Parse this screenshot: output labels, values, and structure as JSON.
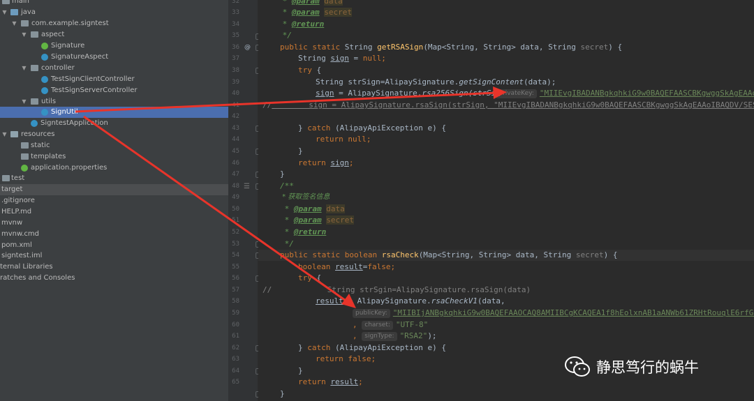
{
  "project_tree": {
    "items": [
      {
        "label": "main"
      },
      {
        "label": "java"
      },
      {
        "label": "com.example.signtest"
      },
      {
        "label": "aspect"
      },
      {
        "label": "Signature"
      },
      {
        "label": "SignatureAspect"
      },
      {
        "label": "controller"
      },
      {
        "label": "TestSignClientController"
      },
      {
        "label": "TestSignServerController"
      },
      {
        "label": "utils"
      },
      {
        "label": "SignUtil"
      },
      {
        "label": "SigntestApplication"
      },
      {
        "label": "resources"
      },
      {
        "label": "static"
      },
      {
        "label": "templates"
      },
      {
        "label": "application.properties"
      },
      {
        "label": "test"
      },
      {
        "label": "target"
      },
      {
        "label": ".gitignore"
      },
      {
        "label": "HELP.md"
      },
      {
        "label": "mvnw"
      },
      {
        "label": "mvnw.cmd"
      },
      {
        "label": "pom.xml"
      },
      {
        "label": "signtest.iml"
      },
      {
        "label": "ternal Libraries"
      },
      {
        "label": "ratches and Consoles"
      }
    ]
  },
  "gutter": {
    "line_numbers": [
      "32",
      "33",
      "34",
      "35",
      "36",
      "37",
      "38",
      "39",
      "40",
      "41",
      "42",
      "43",
      "44",
      "45",
      "46",
      "47",
      "48",
      "49",
      "50",
      "51",
      "52",
      "53",
      "54",
      "55",
      "56",
      "57",
      "58",
      "59",
      "60",
      "61",
      "62",
      "63",
      "64",
      "65"
    ],
    "annotation_marker": "@"
  },
  "code": {
    "l32": {
      "star": " * ",
      "tag": "@param",
      "par": "data"
    },
    "l33": {
      "star": " * ",
      "tag": "@param",
      "par": "secret"
    },
    "l34": {
      "star": " * ",
      "tag": "@return"
    },
    "l35": {
      "text": " */"
    },
    "l36": {
      "kw1": "public static ",
      "type1": "String ",
      "name": "getRSASign",
      "sig": "(Map<String, String> data, String ",
      "secret": "secret",
      "end": ") {"
    },
    "l37": {
      "type": "String ",
      "var": "sign",
      "eq": " = ",
      "kw": "null",
      "end": ";"
    },
    "l38": {
      "kw": "try",
      "end": " {"
    },
    "l39": {
      "a": "String strSign=AlipaySignature.",
      "b": "getSignContent",
      "c": "(data);"
    },
    "l40": {
      "var": "sign",
      "a": " = AlipaySignature.",
      "b": "rsa256Sign(strSi",
      "hint": "privateKey:",
      "str": "\"MIIEvgIBADANBgkqhkiG9w0BAQEFAASCBKgwggSkAgEAAoIBAQDV/SES"
    },
    "l41": {
      "cmt": "//",
      "code": "        sign = AlipaySignature.rsaSign(strSign, \"MIIEvgIBADANBgkqhkiG9w0BAQEFAASCBKgwggSkAgEAAoIBAQDV/SES"
    },
    "l42": {
      "text": ""
    },
    "l43": {
      "a": "} ",
      "kw": "catch",
      "b": " (AlipayApiException e) {"
    },
    "l44": {
      "kw": "return null",
      "end": ";"
    },
    "l45": {
      "text": "}"
    },
    "l46": {
      "kw": "return ",
      "var": "sign",
      "end": ";"
    },
    "l47": {
      "text": "}"
    },
    "l48": {
      "text": "/**"
    },
    "l49": {
      "text": " * 获取签名信息"
    },
    "l50": {
      "star": " * ",
      "tag": "@param",
      "par": "data"
    },
    "l51": {
      "star": " * ",
      "tag": "@param",
      "par": "secret"
    },
    "l52": {
      "star": " * ",
      "tag": "@return"
    },
    "l53": {
      "text": " */"
    },
    "l54": {
      "kw1": "public static boolean ",
      "name": "rsaCheck",
      "sig": "(Map<String, String> data, String ",
      "secret": "secret",
      "end": ") {"
    },
    "l55": {
      "kw": "boolean ",
      "var": "result",
      "eq": "=",
      "kw2": "false",
      "end": ";"
    },
    "l56": {
      "kw": "try",
      "end": " {"
    },
    "l57": {
      "cmt": "//",
      "code": "            String strSgin=AlipaySignature.rsaSign(data)"
    },
    "l58": {
      "var": "result",
      "a": " = AlipaySignature.",
      "b": "rsaCheckV1",
      "c": "(data,"
    },
    "l59": {
      "hint": "publicKey:",
      "str": "\"MIIBIjANBgkqhkiG9w0BAQEFAAOCAQ8AMIIBCgKCAQEA1f8hEolxnAB1aANWb61ZRHtRouqlE6rfG0V+R"
    },
    "l60": {
      "comma": ", ",
      "hint": "charset:",
      "str": "\"UTF-8\""
    },
    "l61": {
      "comma": ", ",
      "hint": "signType:",
      "str": "\"RSA2\"",
      "end": ");"
    },
    "l62": {
      "a": "} ",
      "kw": "catch",
      "b": " (AlipayApiException e) {"
    },
    "l63": {
      "kw": "return false",
      "end": ";"
    },
    "l64": {
      "text": "}"
    },
    "l65": {
      "kw": "return ",
      "var": "result",
      "end": ";"
    },
    "l66": {
      "text": "}"
    }
  },
  "watermark": {
    "text": "静思笃行的蜗牛",
    "icon": "wechat-icon"
  },
  "colors": {
    "selection": "#4b6eaf",
    "arrow": "#e8342a",
    "keyword": "#cc7832",
    "string": "#6a8759",
    "method": "#ffc66d"
  }
}
